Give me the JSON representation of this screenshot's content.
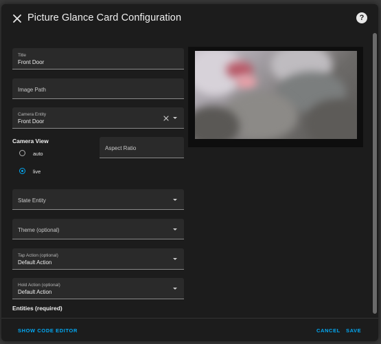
{
  "dialog": {
    "title": "Picture Glance Card Configuration"
  },
  "fields": {
    "title": {
      "label": "Title",
      "value": "Front Door"
    },
    "image_path": {
      "placeholder": "Image Path"
    },
    "camera_entity": {
      "label": "Camera Entity",
      "value": "Front Door"
    },
    "aspect_ratio": {
      "placeholder": "Aspect Ratio"
    },
    "state_entity": {
      "placeholder": "State Entity"
    },
    "theme": {
      "placeholder": "Theme (optional)"
    },
    "tap_action": {
      "label": "Tap Action (optional)",
      "value": "Default Action"
    },
    "hold_action": {
      "label": "Hold Action (optional)",
      "value": "Default Action"
    }
  },
  "camera_view": {
    "label": "Camera View",
    "options": [
      {
        "label": "auto",
        "checked": false
      },
      {
        "label": "live",
        "checked": true
      }
    ]
  },
  "entities": {
    "label": "Entities (required)"
  },
  "footer": {
    "show_code_editor": "SHOW CODE EDITOR",
    "cancel": "CANCEL",
    "save": "SAVE"
  },
  "colors": {
    "accent": "#03a9f4",
    "dialog_bg": "#1c1c1c",
    "field_bg": "#2a2a2a"
  }
}
